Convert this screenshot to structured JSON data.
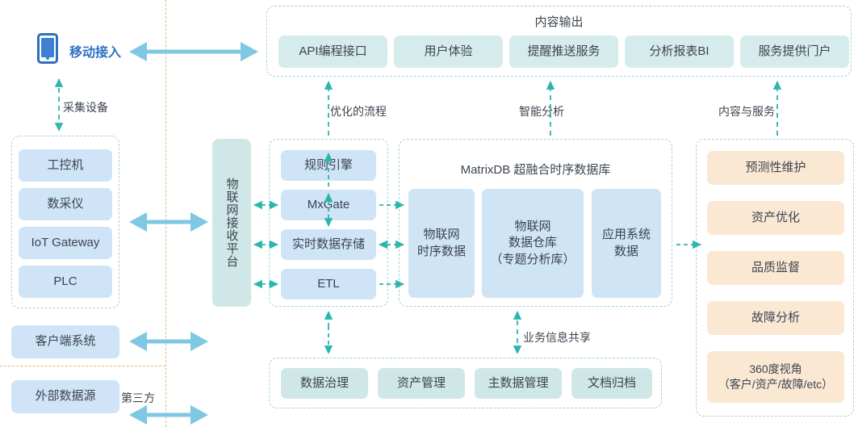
{
  "diagram": {
    "mobile": {
      "label": "移动接入",
      "icon": "mobile-phone-icon",
      "color": "#2f72c4"
    },
    "labels": {
      "collect_device": "采集设备",
      "optimized_process": "优化的流程",
      "smart_analysis": "智能分析",
      "content_and_service": "内容与服务",
      "business_info_share": "业务信息共享",
      "third_party": "第三方"
    },
    "left_column": {
      "device_group": {
        "items": [
          "工控机",
          "数采仪",
          "IoT Gateway",
          "PLC"
        ]
      },
      "client_system": "客户端系统",
      "external_source": "外部数据源"
    },
    "platform_bar": {
      "label": "物联网接收平台"
    },
    "middle_stack": {
      "items": [
        "规则引擎",
        "MxGate",
        "实时数据存储",
        "ETL"
      ]
    },
    "matrixdb": {
      "title": "MatrixDB 超融合时序数据库",
      "items": [
        "物联网\n时序数据",
        "物联网\n数据仓库\n（专题分析库）",
        "应用系统\n数据"
      ]
    },
    "top_output": {
      "title": "内容输出",
      "items": [
        "API编程接口",
        "用户体验",
        "提醒推送服务",
        "分析报表BI",
        "服务提供门户"
      ]
    },
    "bottom_row": {
      "items": [
        "数据治理",
        "资产管理",
        "主数据管理",
        "文档归档"
      ]
    },
    "right_column": {
      "items": [
        "预测性维护",
        "资产优化",
        "品质监督",
        "故障分析",
        "360度视角\n（客户/资产/故障/etc）"
      ]
    },
    "colors": {
      "light_blue_box": "#cfe4f7",
      "mint_box": "#d6ecec",
      "cream_box": "#fbe8d3",
      "teal_arrow": "#2bb6ac",
      "blue_arrow": "#7ec8e3",
      "dashed_blue": "#a8cfe6",
      "dashed_teal": "#9fd5d2",
      "divider_orange": "#e3b97a"
    }
  }
}
